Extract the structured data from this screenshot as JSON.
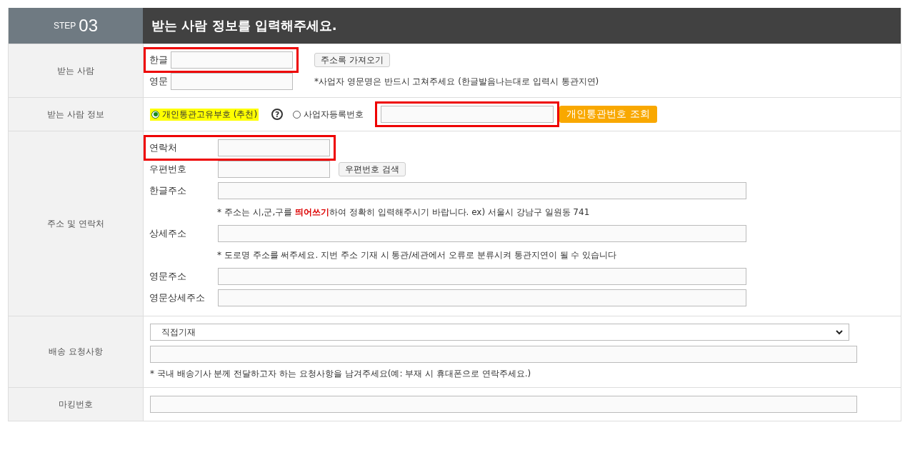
{
  "header": {
    "step_label": "STEP",
    "step_number": "03",
    "title": "받는 사람 정보를 입력해주세요."
  },
  "sections": [
    {
      "kind": "names",
      "label": "받는 사람",
      "rows": [
        {
          "label": "한글",
          "highlighted": true,
          "button": "주소록 가져오기"
        },
        {
          "label": "영문",
          "highlighted": false,
          "note": "*사업자 영문명은 반드시 고쳐주세요 (한글발음나는대로 입력시 통관지연)"
        }
      ]
    },
    {
      "kind": "customs",
      "label": "받는 사람 정보",
      "radios": [
        {
          "label": "개인통관고유부호 (추천)",
          "selected": true,
          "highlighted": true
        },
        {
          "label": "사업자등록번호",
          "selected": false,
          "highlighted": false
        }
      ],
      "help_mark": "?",
      "field_highlighted": true,
      "button": "개인통관번호 조회"
    },
    {
      "kind": "address",
      "label": "주소 및 연락처",
      "rows": [
        {
          "kind": "short",
          "label": "연락처",
          "highlighted": true
        },
        {
          "kind": "short",
          "label": "우편번호",
          "highlighted": false,
          "button": "우편번호 검색"
        },
        {
          "kind": "wide",
          "label": "한글주소",
          "highlighted": false
        },
        {
          "kind": "note",
          "text": "* 주소는 시,군,구를 **띄어쓰기**하여 정확히 입력해주시기 바랍니다. ex) 서울시 강남구 일원동 741"
        },
        {
          "kind": "wide",
          "label": "상세주소",
          "highlighted": false
        },
        {
          "kind": "note",
          "text": "* 도로명 주소를 써주세요. 지번 주소 기재 시 통관/세관에서 오류로 분류시켜 통관지연이 될 수 있습니다"
        },
        {
          "kind": "wide",
          "label": "영문주소",
          "highlighted": false
        },
        {
          "kind": "wide",
          "label": "영문상세주소",
          "highlighted": false
        }
      ]
    },
    {
      "kind": "delivery",
      "label": "배송 요청사항",
      "select_value": "직접기재",
      "note": "* 국내 배송기사 분께 전달하고자 하는 요청사항을 남겨주세요(예: 부재 시 휴대폰으로 연락주세요.)"
    },
    {
      "kind": "marking",
      "label": "마킹번호"
    }
  ]
}
